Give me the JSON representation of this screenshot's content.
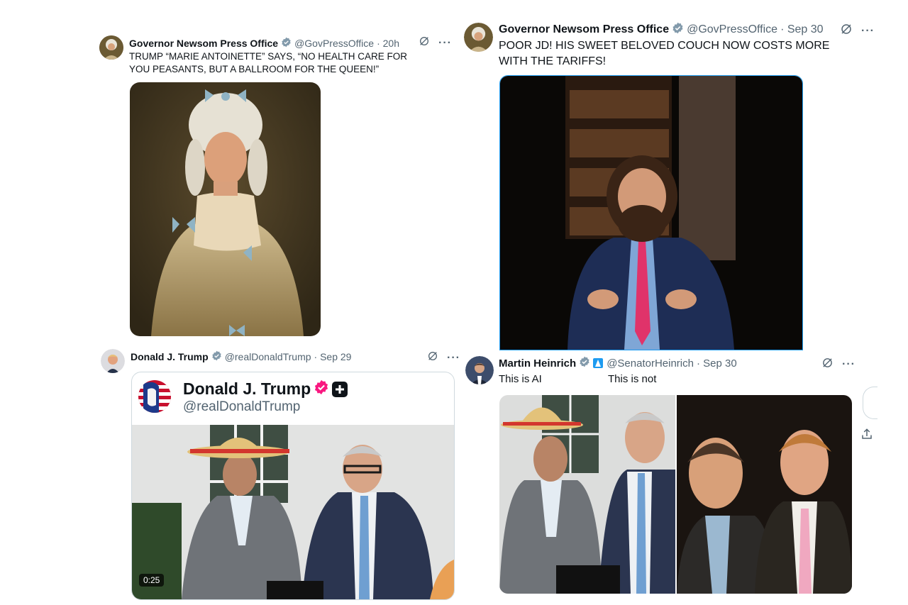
{
  "tweets": [
    {
      "name": "Governor Newsom Press Office",
      "handle": "@GovPressOffice",
      "time": "· 20h",
      "text": "TRUMP “MARIE ANTOINETTE” SAYS, “NO HEALTH CARE FOR YOU PEASANTS, BUT A BALLROOM FOR THE QUEEN!”"
    },
    {
      "name": "Governor Newsom Press Office",
      "handle": "@GovPressOffice",
      "time": "· Sep 30",
      "text": "POOR JD! HIS SWEET BELOVED COUCH NOW COSTS MORE WITH THE TARIFFS!"
    },
    {
      "name": "Donald J. Trump",
      "handle": "@realDonaldTrump",
      "time": "· Sep 29",
      "card_name": "Donald J. Trump",
      "card_handle": "@realDonaldTrump",
      "video_duration": "0:25"
    },
    {
      "name": "Martin Heinrich",
      "handle": "@SenatorHeinrich",
      "time": "· Sep 30",
      "label_left": "This is AI",
      "label_right": "This is not"
    }
  ],
  "icons": {
    "verified_badge": "verified-badge-icon",
    "grok": "grok-icon",
    "more": "more-icon",
    "share": "share-icon"
  },
  "colors": {
    "verified_gray": "#829aab",
    "verified_pink": "#f91880",
    "link_blue": "#1d9bf0"
  }
}
